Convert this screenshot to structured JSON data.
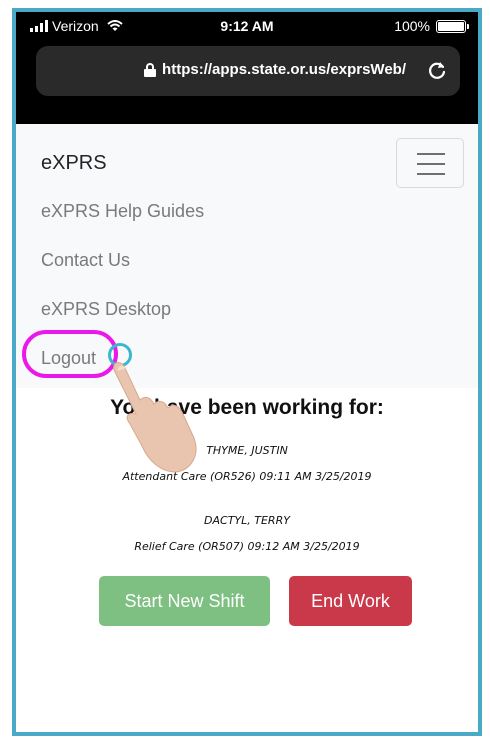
{
  "status_bar": {
    "carrier": "Verizon",
    "time": "9:12 AM",
    "battery": "100%",
    "battery_level": 1.0
  },
  "browser": {
    "url": "https://apps.state.or.us/exprsWeb/"
  },
  "navbar": {
    "brand": "eXPRS",
    "links": [
      {
        "label": "eXPRS Help Guides"
      },
      {
        "label": "Contact Us"
      },
      {
        "label": "eXPRS Desktop"
      },
      {
        "label": "Logout"
      }
    ]
  },
  "main": {
    "heading": "You have been working for:",
    "entries": [
      {
        "name": "THYME, JUSTIN",
        "details": "Attendant Care (OR526)  09:11 AM  3/25/2019"
      },
      {
        "name": "DACTYL, TERRY",
        "details": "Relief Care (OR507)  09:12 AM  3/25/2019"
      }
    ],
    "buttons": {
      "start": "Start New Shift",
      "end": "End Work"
    }
  },
  "colors": {
    "frame": "#4aa9c6",
    "highlight": "#ea19ea",
    "start_button": "#7dc082",
    "end_button": "#c9394a"
  },
  "icons": [
    "signal-icon",
    "wifi-icon",
    "battery-icon",
    "lock-icon",
    "reload-icon",
    "hamburger-icon",
    "hand-pointer-icon"
  ]
}
